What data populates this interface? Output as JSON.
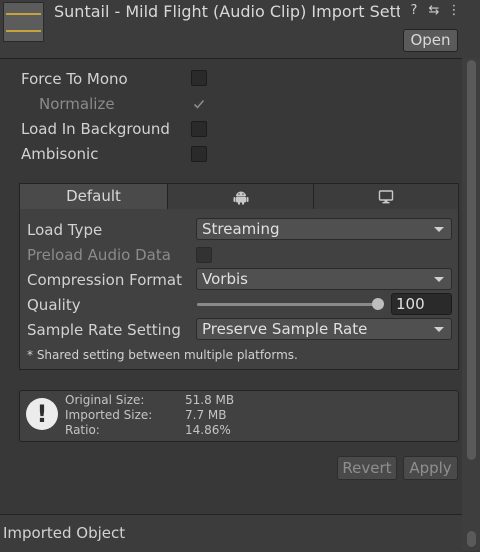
{
  "header": {
    "title": "Suntail - Mild Flight (Audio Clip) Import Setti",
    "help_icon": "?",
    "settings_icon": "⇆",
    "more_icon": "⋮",
    "open_label": "Open"
  },
  "options": {
    "force_to_mono": "Force To Mono",
    "normalize": "Normalize",
    "load_in_background": "Load In Background",
    "ambisonic": "Ambisonic",
    "force_to_mono_checked": false,
    "normalize_checked": true,
    "load_in_background_checked": false,
    "ambisonic_checked": false
  },
  "tabs": {
    "default": "Default",
    "android_icon": "android-icon",
    "standalone_icon": "monitor-icon"
  },
  "platform": {
    "load_type_label": "Load Type",
    "load_type_value": "Streaming",
    "preload_label": "Preload Audio Data",
    "preload_checked": false,
    "compression_label": "Compression Format",
    "compression_value": "Vorbis",
    "quality_label": "Quality",
    "quality_value": "100",
    "quality_fraction": 1.0,
    "sample_rate_label": "Sample Rate Setting",
    "sample_rate_value": "Preserve Sample Rate",
    "note": "* Shared setting between multiple platforms."
  },
  "info": {
    "original_size_label": "Original Size:",
    "original_size_value": "51.8 MB",
    "imported_size_label": "Imported Size:",
    "imported_size_value": "7.7 MB",
    "ratio_label": "Ratio:",
    "ratio_value": "14.86%",
    "icon": "!"
  },
  "actions": {
    "revert": "Revert",
    "apply": "Apply"
  },
  "footer": {
    "label": "Imported Object"
  },
  "colors": {
    "background": "#383838",
    "panel": "#414141",
    "waveform": "#c7a33b"
  }
}
